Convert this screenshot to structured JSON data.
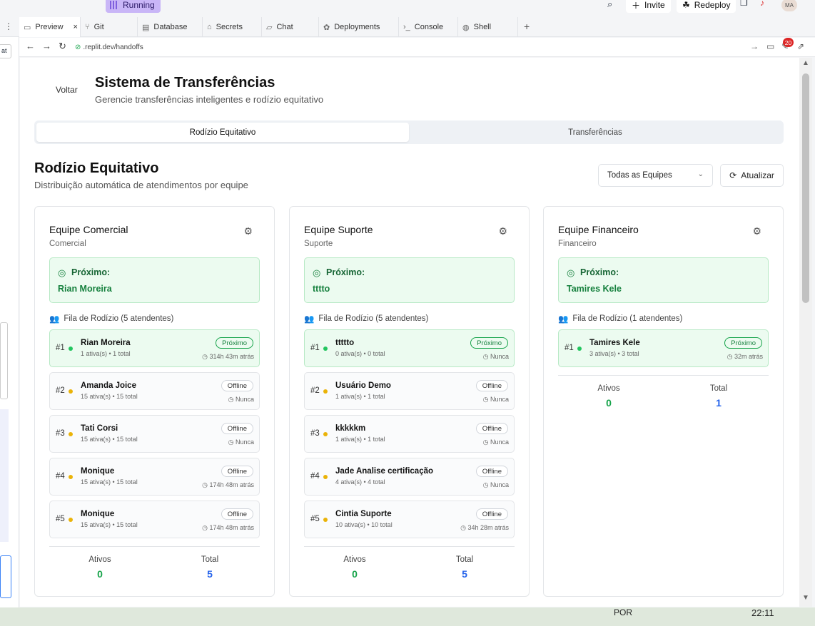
{
  "topbar": {
    "running": "Running",
    "invite": "Invite",
    "redeploy": "Redeploy",
    "avatar": "MA"
  },
  "tabs": [
    "Preview",
    "Git",
    "Database",
    "Secrets",
    "Chat",
    "Deployments",
    "Console",
    "Shell"
  ],
  "url": ".replit.dev/handoffs",
  "notifications": "20",
  "page": {
    "back": "Voltar",
    "title": "Sistema de Transferências",
    "subtitle": "Gerencie transferências inteligentes e rodízio equitativo",
    "segments": [
      "Rodízio Equitativo",
      "Transferências"
    ],
    "section_title": "Rodízio Equitativo",
    "section_subtitle": "Distribuição automática de atendimentos por equipe",
    "team_select": "Todas as Equipes",
    "refresh": "Atualizar",
    "next_label": "Próximo:",
    "stats_active": "Ativos",
    "stats_total": "Total"
  },
  "teams": [
    {
      "name": "Equipe Comercial",
      "type": "Comercial",
      "next": "Rian Moreira",
      "queue": "Fila de Rodízio (5 atendentes)",
      "active": "0",
      "total": "5",
      "members": [
        {
          "pos": "#1",
          "name": "Rian Moreira",
          "stats": "1 ativa(s) • 1 total",
          "badge": "Próximo",
          "when": "314h 43m atrás"
        },
        {
          "pos": "#2",
          "name": "Amanda Joice",
          "stats": "15 ativa(s) • 15 total",
          "badge": "Offline",
          "when": "Nunca"
        },
        {
          "pos": "#3",
          "name": "Tati Corsi",
          "stats": "15 ativa(s) • 15 total",
          "badge": "Offline",
          "when": "Nunca"
        },
        {
          "pos": "#4",
          "name": "Monique",
          "stats": "15 ativa(s) • 15 total",
          "badge": "Offline",
          "when": "174h 48m atrás"
        },
        {
          "pos": "#5",
          "name": "Monique",
          "stats": "15 ativa(s) • 15 total",
          "badge": "Offline",
          "when": "174h 48m atrás"
        }
      ]
    },
    {
      "name": "Equipe Suporte",
      "type": "Suporte",
      "next": "tttto",
      "queue": "Fila de Rodízio (5 atendentes)",
      "active": "0",
      "total": "5",
      "members": [
        {
          "pos": "#1",
          "name": "ttttto",
          "stats": "0 ativa(s) • 0 total",
          "badge": "Próximo",
          "when": "Nunca"
        },
        {
          "pos": "#2",
          "name": "Usuário Demo",
          "stats": "1 ativa(s) • 1 total",
          "badge": "Offline",
          "when": "Nunca"
        },
        {
          "pos": "#3",
          "name": "kkkkkm",
          "stats": "1 ativa(s) • 1 total",
          "badge": "Offline",
          "when": "Nunca"
        },
        {
          "pos": "#4",
          "name": "Jade Analise certificação",
          "stats": "4 ativa(s) • 4 total",
          "badge": "Offline",
          "when": "Nunca"
        },
        {
          "pos": "#5",
          "name": "Cintia Suporte",
          "stats": "10 ativa(s) • 10 total",
          "badge": "Offline",
          "when": "34h 28m atrás"
        }
      ]
    },
    {
      "name": "Equipe Financeiro",
      "type": "Financeiro",
      "next": "Tamires Kele",
      "queue": "Fila de Rodízio (1 atendentes)",
      "active": "0",
      "total": "1",
      "members": [
        {
          "pos": "#1",
          "name": "Tamires Kele",
          "stats": "3 ativa(s) • 3 total",
          "badge": "Próximo",
          "when": "32m atrás"
        }
      ]
    }
  ],
  "taskbar": {
    "lang": "POR",
    "time": "22:11"
  }
}
